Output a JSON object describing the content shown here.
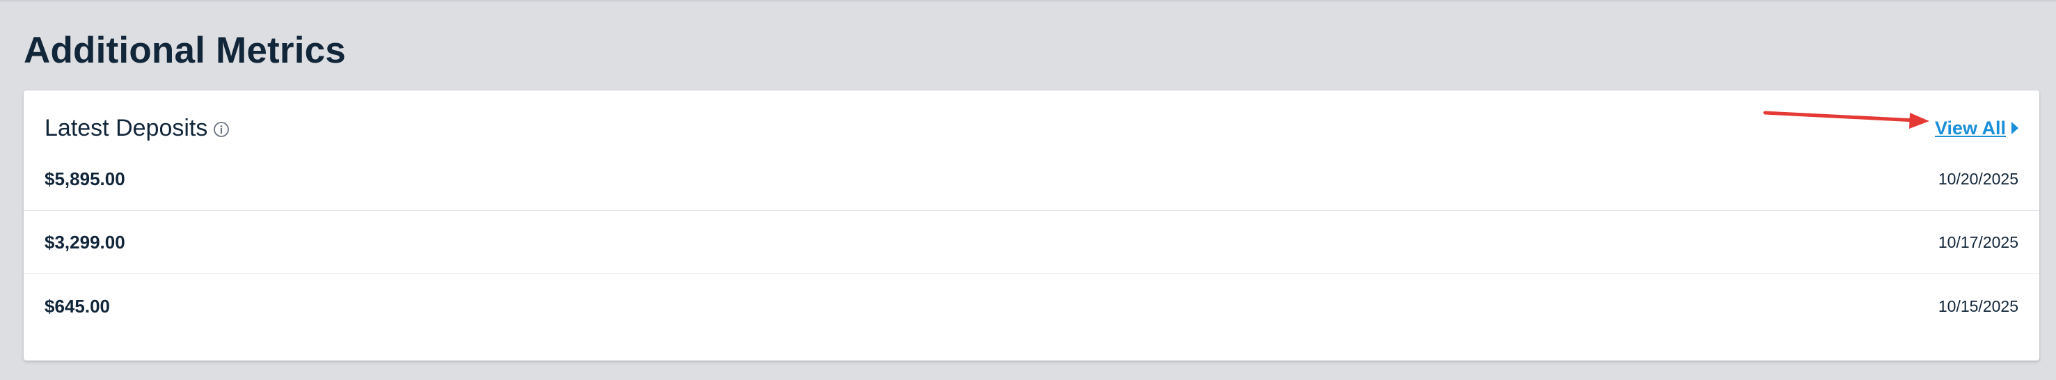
{
  "section": {
    "title": "Additional Metrics"
  },
  "card": {
    "title": "Latest Deposits",
    "info_icon": "info-circle-icon",
    "view_all_label": "View All",
    "view_all_icon": "caret-right-icon"
  },
  "deposits": [
    {
      "amount": "$5,895.00",
      "date": "10/20/2025"
    },
    {
      "amount": "$3,299.00",
      "date": "10/17/2025"
    },
    {
      "amount": "$645.00",
      "date": "10/15/2025"
    }
  ],
  "colors": {
    "page_background": "#dcdee2",
    "card_background": "#ffffff",
    "text_primary": "#12263a",
    "link": "#1a8fd8",
    "annotation_arrow": "#e53935"
  }
}
